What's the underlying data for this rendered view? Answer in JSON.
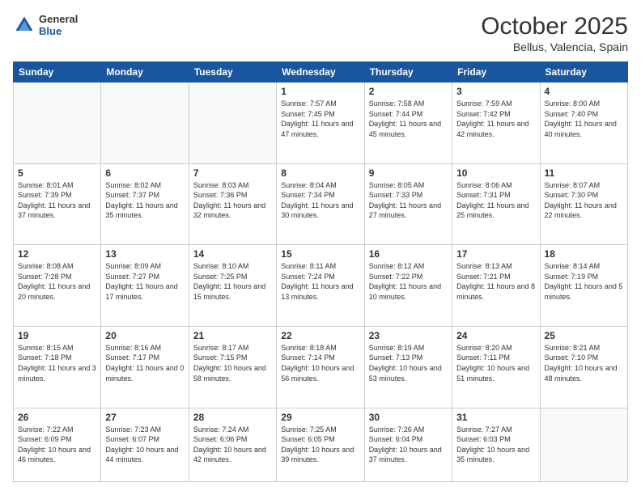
{
  "header": {
    "logo": {
      "general": "General",
      "blue": "Blue"
    },
    "title": "October 2025",
    "location": "Bellus, Valencia, Spain"
  },
  "weekdays": [
    "Sunday",
    "Monday",
    "Tuesday",
    "Wednesday",
    "Thursday",
    "Friday",
    "Saturday"
  ],
  "weeks": [
    [
      null,
      null,
      null,
      {
        "day": "1",
        "sunrise": "7:57 AM",
        "sunset": "7:45 PM",
        "daylight": "11 hours and 47 minutes."
      },
      {
        "day": "2",
        "sunrise": "7:58 AM",
        "sunset": "7:44 PM",
        "daylight": "11 hours and 45 minutes."
      },
      {
        "day": "3",
        "sunrise": "7:59 AM",
        "sunset": "7:42 PM",
        "daylight": "11 hours and 42 minutes."
      },
      {
        "day": "4",
        "sunrise": "8:00 AM",
        "sunset": "7:40 PM",
        "daylight": "11 hours and 40 minutes."
      }
    ],
    [
      {
        "day": "5",
        "sunrise": "8:01 AM",
        "sunset": "7:39 PM",
        "daylight": "11 hours and 37 minutes."
      },
      {
        "day": "6",
        "sunrise": "8:02 AM",
        "sunset": "7:37 PM",
        "daylight": "11 hours and 35 minutes."
      },
      {
        "day": "7",
        "sunrise": "8:03 AM",
        "sunset": "7:36 PM",
        "daylight": "11 hours and 32 minutes."
      },
      {
        "day": "8",
        "sunrise": "8:04 AM",
        "sunset": "7:34 PM",
        "daylight": "11 hours and 30 minutes."
      },
      {
        "day": "9",
        "sunrise": "8:05 AM",
        "sunset": "7:33 PM",
        "daylight": "11 hours and 27 minutes."
      },
      {
        "day": "10",
        "sunrise": "8:06 AM",
        "sunset": "7:31 PM",
        "daylight": "11 hours and 25 minutes."
      },
      {
        "day": "11",
        "sunrise": "8:07 AM",
        "sunset": "7:30 PM",
        "daylight": "11 hours and 22 minutes."
      }
    ],
    [
      {
        "day": "12",
        "sunrise": "8:08 AM",
        "sunset": "7:28 PM",
        "daylight": "11 hours and 20 minutes."
      },
      {
        "day": "13",
        "sunrise": "8:09 AM",
        "sunset": "7:27 PM",
        "daylight": "11 hours and 17 minutes."
      },
      {
        "day": "14",
        "sunrise": "8:10 AM",
        "sunset": "7:25 PM",
        "daylight": "11 hours and 15 minutes."
      },
      {
        "day": "15",
        "sunrise": "8:11 AM",
        "sunset": "7:24 PM",
        "daylight": "11 hours and 13 minutes."
      },
      {
        "day": "16",
        "sunrise": "8:12 AM",
        "sunset": "7:22 PM",
        "daylight": "11 hours and 10 minutes."
      },
      {
        "day": "17",
        "sunrise": "8:13 AM",
        "sunset": "7:21 PM",
        "daylight": "11 hours and 8 minutes."
      },
      {
        "day": "18",
        "sunrise": "8:14 AM",
        "sunset": "7:19 PM",
        "daylight": "11 hours and 5 minutes."
      }
    ],
    [
      {
        "day": "19",
        "sunrise": "8:15 AM",
        "sunset": "7:18 PM",
        "daylight": "11 hours and 3 minutes."
      },
      {
        "day": "20",
        "sunrise": "8:16 AM",
        "sunset": "7:17 PM",
        "daylight": "11 hours and 0 minutes."
      },
      {
        "day": "21",
        "sunrise": "8:17 AM",
        "sunset": "7:15 PM",
        "daylight": "10 hours and 58 minutes."
      },
      {
        "day": "22",
        "sunrise": "8:18 AM",
        "sunset": "7:14 PM",
        "daylight": "10 hours and 56 minutes."
      },
      {
        "day": "23",
        "sunrise": "8:19 AM",
        "sunset": "7:13 PM",
        "daylight": "10 hours and 53 minutes."
      },
      {
        "day": "24",
        "sunrise": "8:20 AM",
        "sunset": "7:11 PM",
        "daylight": "10 hours and 51 minutes."
      },
      {
        "day": "25",
        "sunrise": "8:21 AM",
        "sunset": "7:10 PM",
        "daylight": "10 hours and 48 minutes."
      }
    ],
    [
      {
        "day": "26",
        "sunrise": "7:22 AM",
        "sunset": "6:09 PM",
        "daylight": "10 hours and 46 minutes."
      },
      {
        "day": "27",
        "sunrise": "7:23 AM",
        "sunset": "6:07 PM",
        "daylight": "10 hours and 44 minutes."
      },
      {
        "day": "28",
        "sunrise": "7:24 AM",
        "sunset": "6:06 PM",
        "daylight": "10 hours and 42 minutes."
      },
      {
        "day": "29",
        "sunrise": "7:25 AM",
        "sunset": "6:05 PM",
        "daylight": "10 hours and 39 minutes."
      },
      {
        "day": "30",
        "sunrise": "7:26 AM",
        "sunset": "6:04 PM",
        "daylight": "10 hours and 37 minutes."
      },
      {
        "day": "31",
        "sunrise": "7:27 AM",
        "sunset": "6:03 PM",
        "daylight": "10 hours and 35 minutes."
      },
      null
    ]
  ]
}
